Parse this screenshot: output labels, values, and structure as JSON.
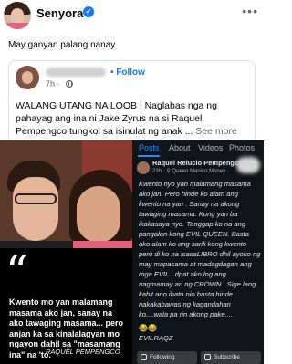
{
  "post": {
    "author": "Senyora",
    "caption": "May ganyan palang nanay",
    "more_icon": "ellipsis-icon"
  },
  "shared": {
    "follow": "• Follow",
    "time": "7h ·",
    "text": "WALANG UTANG NA LOOB | Naglabas nga ng pahayag ang ina ni Jake Zyrus na si Raquel Pempengco tungkol sa isinulat ng anak ...",
    "see_more": "See more"
  },
  "photo": {
    "quote": "Kwento mo yan malamang masama ako jan, sanay na ako tawaging masama... pero anjan ka sa kinalalagyan mo ngayon dahil sa \"masamang ina\" na 'to.",
    "quote_author": "RAQUEL PEMPENGCO",
    "right": {
      "tabs": [
        "Posts",
        "About",
        "Videos",
        "Photos"
      ],
      "name": "Raquel Relucio Pempengco",
      "sub": "23h · ⚲ Queen Manico Money ·",
      "body": "Kwento nyo yan malamang masama ako jan. Pero hinde ko alam ang kwento na yan . Sanay na akong tawaging masama. Kung yan ba ikakasaya nyo. Tanggap ko na ang pangalan kong EVIL QUEEN. Basta ako alam ko ang sarili kong kwento pero di ko na isasaLIBRO dhil ayoko ng may mapasama at madagdagan ang mga EVIL...dpat ako lng ang nagmamay ari ng CROWN...Sige lang kahit ano ibato nio basta hinde nakakabawas ng kagandahan ko....wala pa rin akong pake....",
      "emoji": "😂😂",
      "sign": "EVILRAQZ",
      "btn_follow": "Following",
      "btn_subscribe": "Subscribe"
    }
  }
}
